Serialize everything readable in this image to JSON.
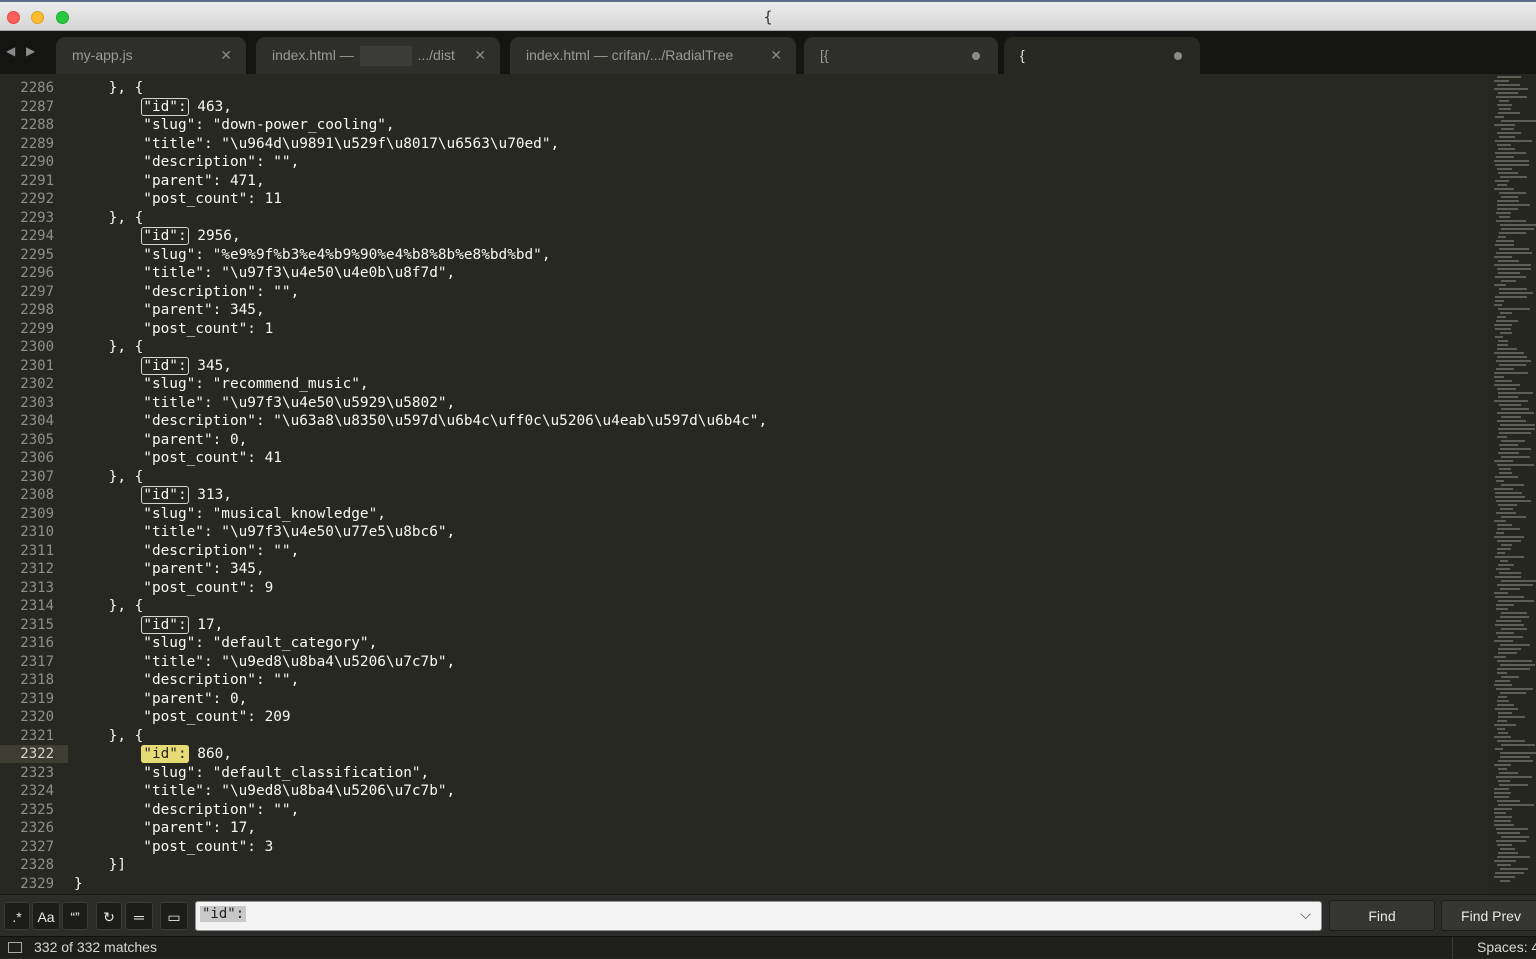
{
  "window": {
    "title": "{"
  },
  "tabs": [
    {
      "label": "my-app.js",
      "state": "close"
    },
    {
      "label_prefix": "index.html —",
      "label_suffix": ".../dist",
      "state": "close"
    },
    {
      "label": "index.html — crifan/.../RadialTree",
      "state": "close"
    },
    {
      "label": "[{",
      "state": "dirty"
    },
    {
      "label": "{",
      "state": "dirty",
      "active": true
    }
  ],
  "editor": {
    "current_line": 2322,
    "lines": [
      {
        "n": 2286,
        "segs": [
          {
            "t": "    }, {"
          }
        ]
      },
      {
        "n": 2287,
        "segs": [
          {
            "t": "        "
          },
          {
            "t": "\"id\":",
            "m": 1
          },
          {
            "t": " 463,"
          }
        ]
      },
      {
        "n": 2288,
        "segs": [
          {
            "t": "        \"slug\": \"down-power_cooling\","
          }
        ]
      },
      {
        "n": 2289,
        "segs": [
          {
            "t": "        \"title\": \"\\u964d\\u9891\\u529f\\u8017\\u6563\\u70ed\","
          }
        ]
      },
      {
        "n": 2290,
        "segs": [
          {
            "t": "        \"description\": \"\","
          }
        ]
      },
      {
        "n": 2291,
        "segs": [
          {
            "t": "        \"parent\": 471,"
          }
        ]
      },
      {
        "n": 2292,
        "segs": [
          {
            "t": "        \"post_count\": 11"
          }
        ]
      },
      {
        "n": 2293,
        "segs": [
          {
            "t": "    }, {"
          }
        ]
      },
      {
        "n": 2294,
        "segs": [
          {
            "t": "        "
          },
          {
            "t": "\"id\":",
            "m": 1
          },
          {
            "t": " 2956,"
          }
        ]
      },
      {
        "n": 2295,
        "segs": [
          {
            "t": "        \"slug\": \"%e9%9f%b3%e4%b9%90%e4%b8%8b%e8%bd%bd\","
          }
        ]
      },
      {
        "n": 2296,
        "segs": [
          {
            "t": "        \"title\": \"\\u97f3\\u4e50\\u4e0b\\u8f7d\","
          }
        ]
      },
      {
        "n": 2297,
        "segs": [
          {
            "t": "        \"description\": \"\","
          }
        ]
      },
      {
        "n": 2298,
        "segs": [
          {
            "t": "        \"parent\": 345,"
          }
        ]
      },
      {
        "n": 2299,
        "segs": [
          {
            "t": "        \"post_count\": 1"
          }
        ]
      },
      {
        "n": 2300,
        "segs": [
          {
            "t": "    }, {"
          }
        ]
      },
      {
        "n": 2301,
        "segs": [
          {
            "t": "        "
          },
          {
            "t": "\"id\":",
            "m": 1
          },
          {
            "t": " 345,"
          }
        ]
      },
      {
        "n": 2302,
        "segs": [
          {
            "t": "        \"slug\": \"recommend_music\","
          }
        ]
      },
      {
        "n": 2303,
        "segs": [
          {
            "t": "        \"title\": \"\\u97f3\\u4e50\\u5929\\u5802\","
          }
        ]
      },
      {
        "n": 2304,
        "segs": [
          {
            "t": "        \"description\": \"\\u63a8\\u8350\\u597d\\u6b4c\\uff0c\\u5206\\u4eab\\u597d\\u6b4c\","
          }
        ]
      },
      {
        "n": 2305,
        "segs": [
          {
            "t": "        \"parent\": 0,"
          }
        ]
      },
      {
        "n": 2306,
        "segs": [
          {
            "t": "        \"post_count\": 41"
          }
        ]
      },
      {
        "n": 2307,
        "segs": [
          {
            "t": "    }, {"
          }
        ]
      },
      {
        "n": 2308,
        "segs": [
          {
            "t": "        "
          },
          {
            "t": "\"id\":",
            "m": 1
          },
          {
            "t": " 313,"
          }
        ]
      },
      {
        "n": 2309,
        "segs": [
          {
            "t": "        \"slug\": \"musical_knowledge\","
          }
        ]
      },
      {
        "n": 2310,
        "segs": [
          {
            "t": "        \"title\": \"\\u97f3\\u4e50\\u77e5\\u8bc6\","
          }
        ]
      },
      {
        "n": 2311,
        "segs": [
          {
            "t": "        \"description\": \"\","
          }
        ]
      },
      {
        "n": 2312,
        "segs": [
          {
            "t": "        \"parent\": 345,"
          }
        ]
      },
      {
        "n": 2313,
        "segs": [
          {
            "t": "        \"post_count\": 9"
          }
        ]
      },
      {
        "n": 2314,
        "segs": [
          {
            "t": "    }, {"
          }
        ]
      },
      {
        "n": 2315,
        "segs": [
          {
            "t": "        "
          },
          {
            "t": "\"id\":",
            "m": 1
          },
          {
            "t": " 17,"
          }
        ]
      },
      {
        "n": 2316,
        "segs": [
          {
            "t": "        \"slug\": \"default_category\","
          }
        ]
      },
      {
        "n": 2317,
        "segs": [
          {
            "t": "        \"title\": \"\\u9ed8\\u8ba4\\u5206\\u7c7b\","
          }
        ]
      },
      {
        "n": 2318,
        "segs": [
          {
            "t": "        \"description\": \"\","
          }
        ]
      },
      {
        "n": 2319,
        "segs": [
          {
            "t": "        \"parent\": 0,"
          }
        ]
      },
      {
        "n": 2320,
        "segs": [
          {
            "t": "        \"post_count\": 209"
          }
        ]
      },
      {
        "n": 2321,
        "segs": [
          {
            "t": "    }, {"
          }
        ]
      },
      {
        "n": 2322,
        "segs": [
          {
            "t": "        "
          },
          {
            "t": "\"id\":",
            "m": 2
          },
          {
            "t": " 860,"
          }
        ]
      },
      {
        "n": 2323,
        "segs": [
          {
            "t": "        \"slug\": \"default_classification\","
          }
        ]
      },
      {
        "n": 2324,
        "segs": [
          {
            "t": "        \"title\": \"\\u9ed8\\u8ba4\\u5206\\u7c7b\","
          }
        ]
      },
      {
        "n": 2325,
        "segs": [
          {
            "t": "        \"description\": \"\","
          }
        ]
      },
      {
        "n": 2326,
        "segs": [
          {
            "t": "        \"parent\": 17,"
          }
        ]
      },
      {
        "n": 2327,
        "segs": [
          {
            "t": "        \"post_count\": 3"
          }
        ]
      },
      {
        "n": 2328,
        "segs": [
          {
            "t": "    }]"
          }
        ]
      },
      {
        "n": 2329,
        "segs": [
          {
            "t": "}"
          }
        ]
      }
    ]
  },
  "find": {
    "regex_label": ".*",
    "case_label": "Aa",
    "word_label": "“”",
    "query": "\"id\":",
    "find_label": "Find",
    "find_prev_label": "Find Prev"
  },
  "status": {
    "matches": "332 of 332 matches",
    "spaces": "Spaces: 4"
  },
  "colors": {
    "background": "#272822",
    "match_highlight": "#e6db74",
    "text": "#f8f8f2",
    "gutter": "#8f908a"
  },
  "icons": [
    "close-icon",
    "dirty-dot-icon",
    "back-arrow-icon",
    "forward-arrow-icon",
    "wrap-icon",
    "in-selection-icon",
    "highlight-icon",
    "chevron-down-icon",
    "panel-icon"
  ]
}
